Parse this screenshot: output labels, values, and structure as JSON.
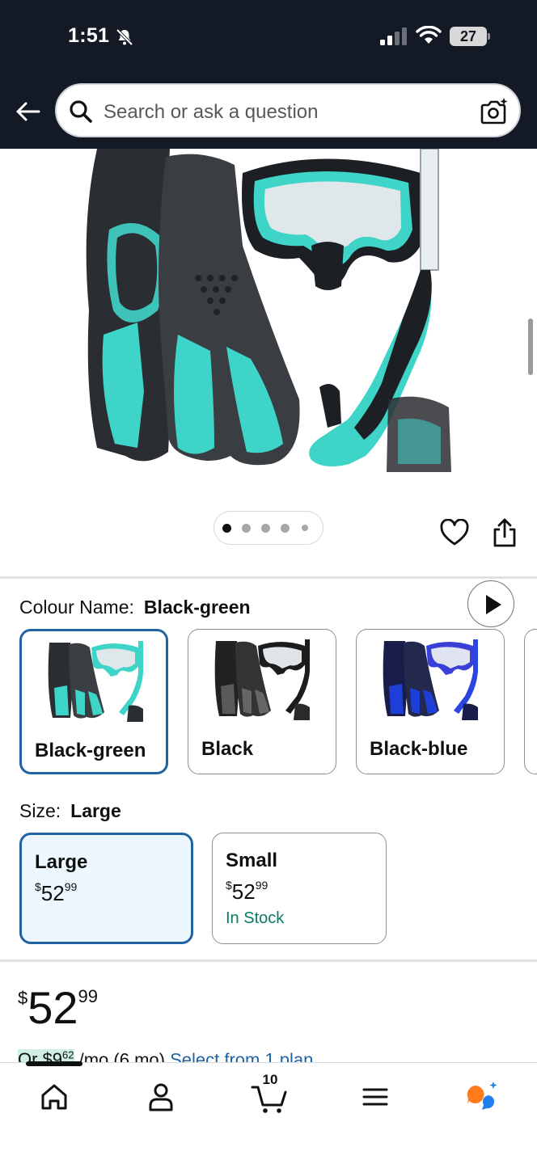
{
  "status_bar": {
    "time": "1:51",
    "battery": "27"
  },
  "header": {
    "search_placeholder": "Search or ask a question",
    "icons": [
      "back-arrow-icon",
      "search-icon",
      "camera-search-icon"
    ]
  },
  "gallery": {
    "image_count": 5,
    "active_index": 0,
    "icons": [
      "play-icon",
      "heart-icon",
      "share-icon"
    ]
  },
  "colour": {
    "label": "Colour Name:",
    "selected": "Black-green",
    "options": [
      {
        "label": "Black-green",
        "accent": "#3fd4c8"
      },
      {
        "label": "Black",
        "accent": "#3a3a3a"
      },
      {
        "label": "Black-blue",
        "accent": "#1d3fd8"
      }
    ]
  },
  "size": {
    "label": "Size:",
    "selected": "Large",
    "options": [
      {
        "name": "Large",
        "currency": "$",
        "whole": "52",
        "fraction": "99",
        "stock": ""
      },
      {
        "name": "Small",
        "currency": "$",
        "whole": "52",
        "fraction": "99",
        "stock": "In Stock"
      }
    ]
  },
  "price": {
    "currency": "$",
    "whole": "52",
    "fraction": "99"
  },
  "installment": {
    "prefix": "Or $9",
    "fraction": "62",
    "per_month": " /mo (6 mo) ",
    "link": "Select from 1 plan"
  },
  "bottom_nav": {
    "cart_count": "10",
    "items": [
      "home-icon",
      "account-icon",
      "cart-icon",
      "menu-icon",
      "rufus-assistant-icon"
    ]
  },
  "colors": {
    "header_bg": "#131a26",
    "selected_border": "#2162a1",
    "in_stock": "#067d62",
    "link": "#2162a1",
    "product_teal": "#3fd4c8"
  }
}
